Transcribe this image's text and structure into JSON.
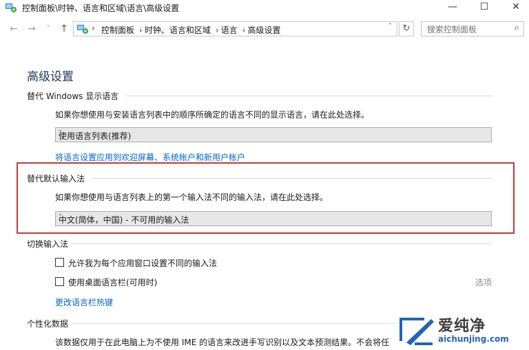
{
  "window": {
    "title": "控制面板\\时钟、语言和区域\\语言\\高级设置",
    "minimize_glyph": "—",
    "maximize_glyph": "☐",
    "close_glyph": "✕"
  },
  "nav": {
    "back_glyph": "←",
    "forward_glyph": "→",
    "recent_glyph": "˅",
    "up_glyph": "↑"
  },
  "address": {
    "crumbs": [
      "控制面板",
      "时钟、语言和区域",
      "语言",
      "高级设置"
    ],
    "separator": "›",
    "dropdown_glyph": "˅",
    "refresh_glyph": "↻"
  },
  "search": {
    "placeholder": "搜索控制面板",
    "icon_glyph": "⌕"
  },
  "page": {
    "title": "高级设置",
    "section1": {
      "heading": "替代 Windows 显示语言",
      "description": "如果你想使用与安装语言列表中的顺序所确定的语言不同的显示语言，请在此处选择。",
      "select_value": "使用语言列表(推荐)",
      "link": "将语言设置应用到欢迎屏幕、系统帐户和新用户帐户"
    },
    "section2": {
      "heading": "替代默认输入法",
      "description": "如果你想使用与语言列表上的第一个输入法不同的输入法，请在此处选择。",
      "select_value": "中文(简体，中国) - 不可用的输入法"
    },
    "section3": {
      "heading": "切换输入法",
      "checkbox1": "允许我为每个应用窗口设置不同的输入法",
      "checkbox2": "使用桌面语言栏(可用时)",
      "options_link": "选项",
      "hotkey_link": "更改语言栏热键"
    },
    "section4": {
      "heading": "个性化数据",
      "description": "该数据仅用于在此电脑上为不使用 IME 的语言来改进手写识别以及文本预测结果。不会将任"
    },
    "select_arrow_glyph": "˅"
  },
  "watermark": {
    "name": "爱纯净",
    "domain": "aichunjing.com"
  },
  "colors": {
    "highlight": "#c0393b",
    "link": "#0066cc",
    "title": "#1e395b"
  }
}
